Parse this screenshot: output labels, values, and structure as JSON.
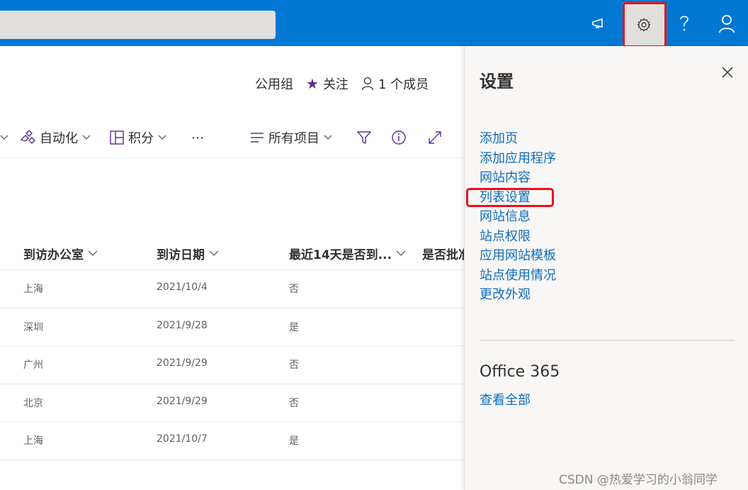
{
  "header": {
    "group_type": "公用组",
    "follow_label": "关注",
    "members_label": "1 个成员"
  },
  "commands": {
    "automate": "自动化",
    "integrate": "积分",
    "more": "⋯",
    "view": "所有项目"
  },
  "table": {
    "columns": [
      "到访办公室",
      "到访日期",
      "最近14天是否到...",
      "是否批准"
    ],
    "rows": [
      [
        "上海",
        "2021/10/4",
        "否"
      ],
      [
        "深圳",
        "2021/9/28",
        "是"
      ],
      [
        "广州",
        "2021/9/29",
        "否"
      ],
      [
        "北京",
        "2021/9/29",
        "否"
      ],
      [
        "上海",
        "2021/10/7",
        "是"
      ]
    ]
  },
  "settings_panel": {
    "title": "设置",
    "links": [
      "添加页",
      "添加应用程序",
      "网站内容",
      "列表设置",
      "网站信息",
      "站点权限",
      "应用网站模板",
      "站点使用情况",
      "更改外观"
    ],
    "section_title": "Office 365",
    "view_all": "查看全部"
  },
  "watermark": "CSDN @热爱学习的小翁同学",
  "colors": {
    "suite_bar": "#0078d4",
    "link": "#0f6cbd",
    "highlight": "#e8101b",
    "follow_star": "#5c2e91"
  }
}
